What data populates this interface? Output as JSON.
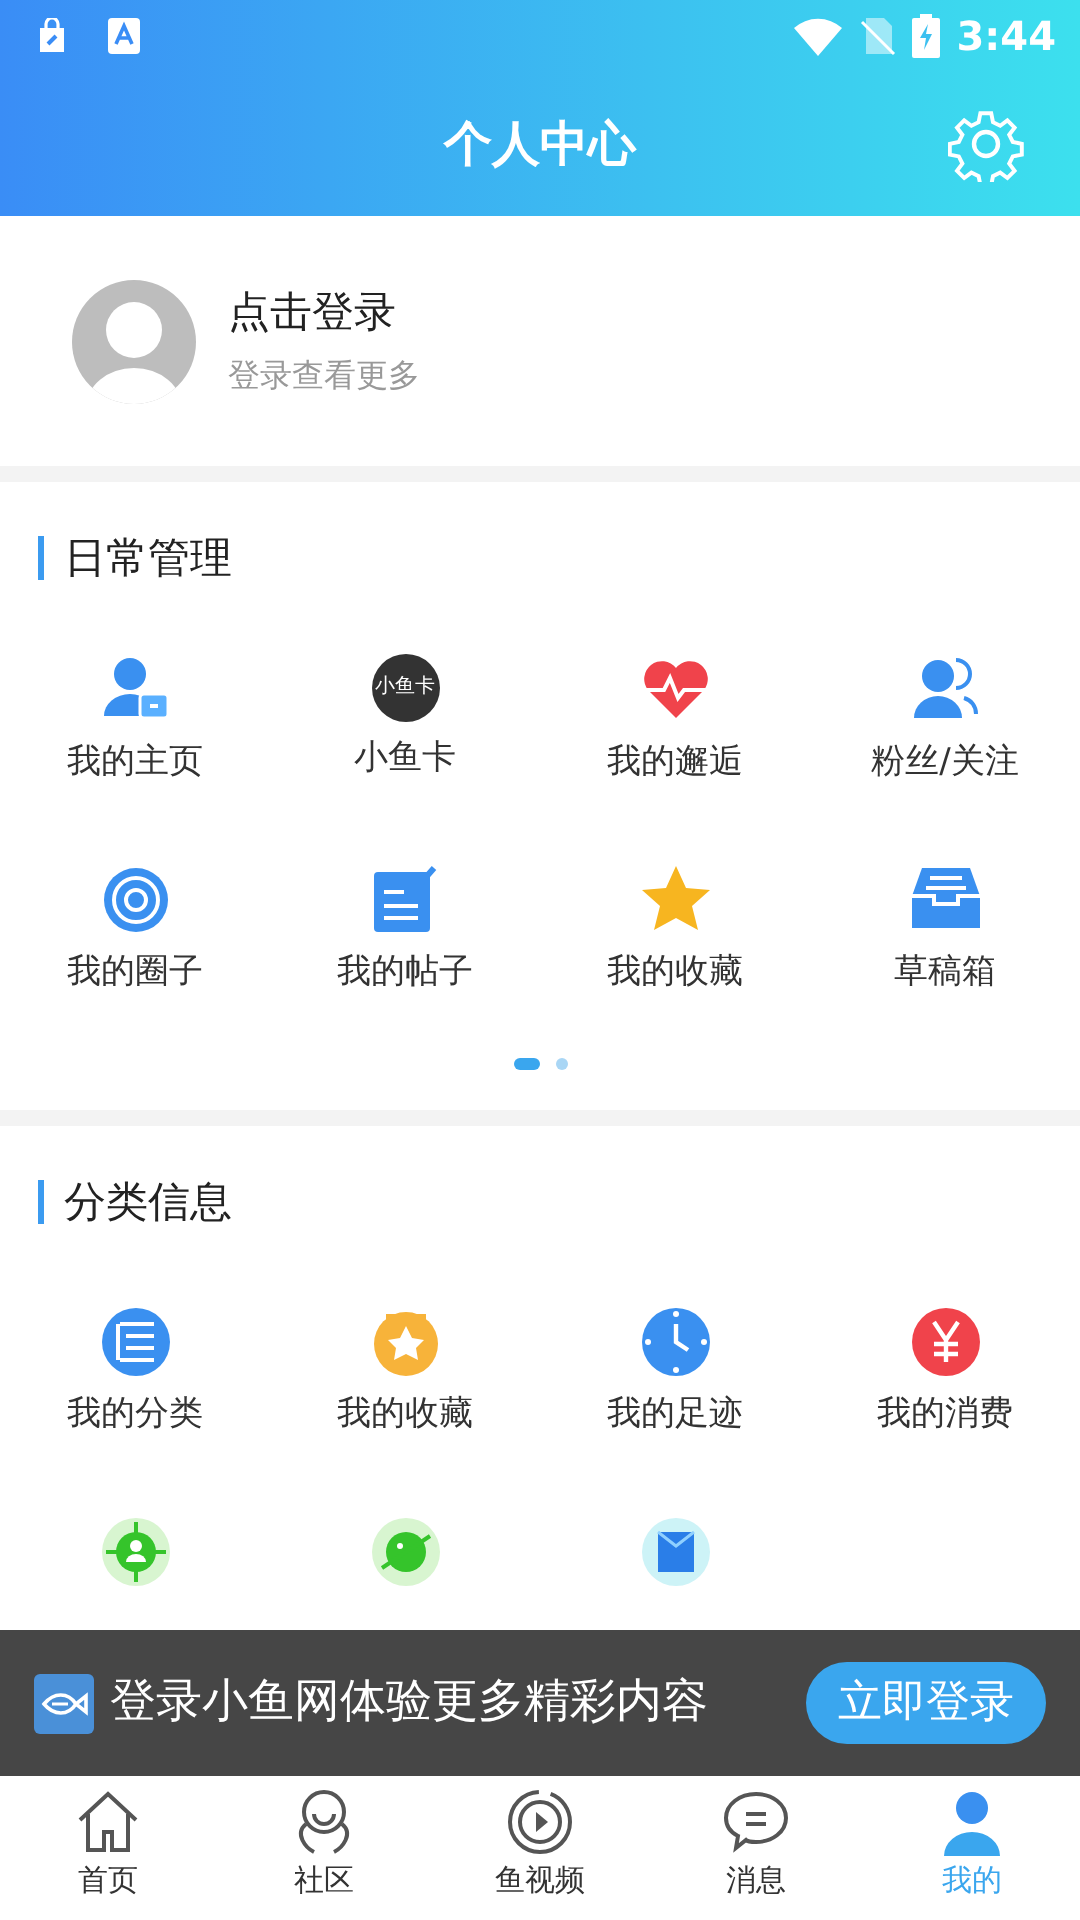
{
  "status_bar": {
    "time": "3:44"
  },
  "header": {
    "title": "个人中心"
  },
  "profile": {
    "name": "点击登录",
    "subtitle": "登录查看更多"
  },
  "daily": {
    "title": "日常管理",
    "items": [
      {
        "label": "我的主页"
      },
      {
        "label": "小鱼卡",
        "icon_text": "小鱼卡"
      },
      {
        "label": "我的邂逅"
      },
      {
        "label": "粉丝/关注"
      },
      {
        "label": "我的圈子"
      },
      {
        "label": "我的帖子"
      },
      {
        "label": "我的收藏"
      },
      {
        "label": "草稿箱"
      }
    ],
    "pages": [
      {
        "selected": true
      },
      {
        "selected": false
      }
    ]
  },
  "category": {
    "title": "分类信息",
    "items": [
      {
        "label": "我的分类"
      },
      {
        "label": "我的收藏"
      },
      {
        "label": "我的足迹"
      },
      {
        "label": "我的消费"
      }
    ]
  },
  "login_banner": {
    "text": "登录小鱼网体验更多精彩内容",
    "button": "立即登录"
  },
  "tabs": [
    {
      "label": "首页",
      "selected": false
    },
    {
      "label": "社区",
      "selected": false
    },
    {
      "label": "鱼视频",
      "selected": false
    },
    {
      "label": "消息",
      "selected": false
    },
    {
      "label": "我的",
      "selected": true
    }
  ]
}
